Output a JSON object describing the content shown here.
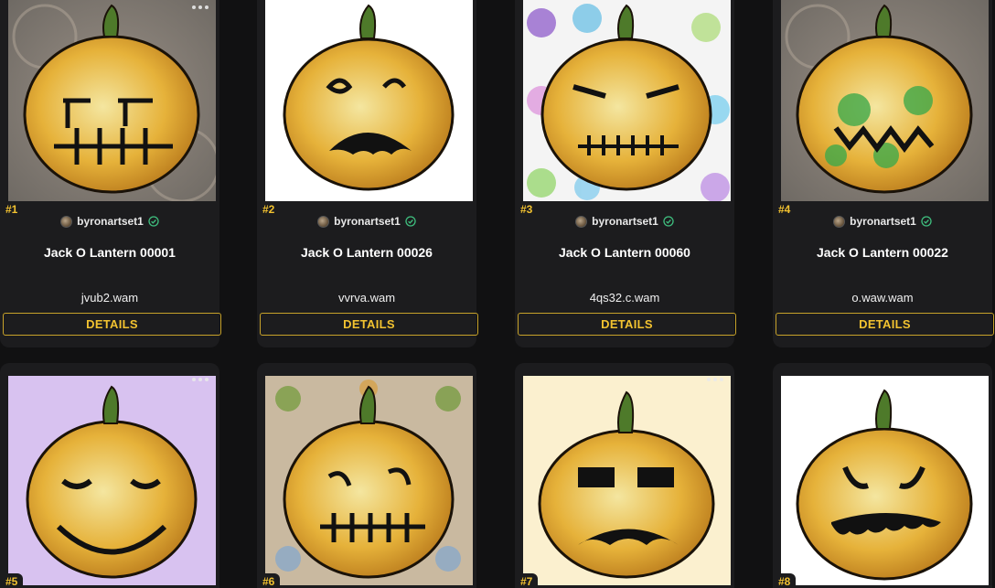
{
  "colors": {
    "page_bg": "#111112",
    "card_bg": "#1c1c1e",
    "accent_gold": "#f2c230",
    "verified_green": "#3fbf7f"
  },
  "cards": [
    {
      "rank": "#1",
      "creator": "byronartset1",
      "title": "Jack O Lantern 00001",
      "owner": "jvub2.wam",
      "details_label": "DETAILS",
      "background": "mosaic-grey"
    },
    {
      "rank": "#2",
      "creator": "byronartset1",
      "title": "Jack O Lantern 00026",
      "owner": "vvrva.wam",
      "details_label": "DETAILS",
      "background": "white"
    },
    {
      "rank": "#3",
      "creator": "byronartset1",
      "title": "Jack O Lantern 00060",
      "owner": "4qs32.c.wam",
      "details_label": "DETAILS",
      "background": "emoji-pattern"
    },
    {
      "rank": "#4",
      "creator": "byronartset1",
      "title": "Jack O Lantern 00022",
      "owner": "o.waw.wam",
      "details_label": "DETAILS",
      "background": "mosaic-grey"
    },
    {
      "rank": "#5",
      "background": "lavender"
    },
    {
      "rank": "#6",
      "background": "kaleidoscope"
    },
    {
      "rank": "#7",
      "background": "cream"
    },
    {
      "rank": "#8",
      "background": "white"
    }
  ],
  "icons": {
    "more": "more-options-icon",
    "verified": "verified-badge-icon",
    "avatar": "creator-avatar"
  }
}
